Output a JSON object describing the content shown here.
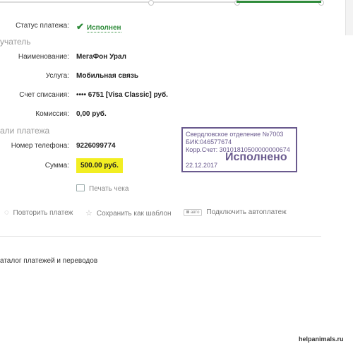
{
  "status": {
    "label": "Статус платежа:",
    "value": "Исполнен"
  },
  "recipient": {
    "section_title": "учатель",
    "fields": [
      {
        "label": "Наименование:",
        "value": "МегаФон Урал"
      },
      {
        "label": "Услуга:",
        "value": "Мобильная связь"
      },
      {
        "label": "Счет списания:",
        "value": "•••• 6751  [Visa Classic]  руб."
      },
      {
        "label": "Комиссия:",
        "value": "0,00 руб."
      }
    ]
  },
  "details": {
    "section_title": "али платежа",
    "phone_label": "Номер телефона:",
    "phone_value": "9226099774",
    "amount_label": "Сумма:",
    "amount_value": "500.00 руб."
  },
  "print_label": "Печать чека",
  "stamp": {
    "line1": "Свердловское отделение №7003",
    "line2": "БИК:046577674",
    "line3": "Корр.Счет: 30101810500000000674",
    "date": "22.12.2017",
    "mark": "Исполнено"
  },
  "actions": {
    "repeat": "Повторить платеж",
    "save_template": "Сохранить как шаблон",
    "auto_badge": "авто",
    "autopay": "Подключить автоплатеж"
  },
  "catalog_link": "аталог платежей и переводов",
  "watermark": "helpanimals.ru",
  "colors": {
    "success": "#2e8b3a",
    "highlight": "#f2ee22",
    "stamp": "#6a5a8e"
  }
}
